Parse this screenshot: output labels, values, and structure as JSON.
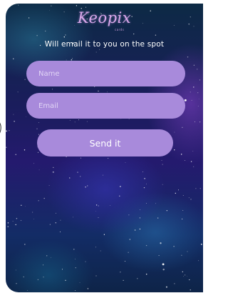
{
  "brand": {
    "logo_text": "Keopix",
    "logo_sub": "cards",
    "accent_color": "#d9a7ea"
  },
  "form": {
    "tagline": "Will email it to you on the spot",
    "name_placeholder": "Name",
    "email_placeholder": "Email",
    "send_label": "Send it",
    "field_color": "#a88adb"
  },
  "background": {
    "description_icon": "starry-nebula-background"
  }
}
